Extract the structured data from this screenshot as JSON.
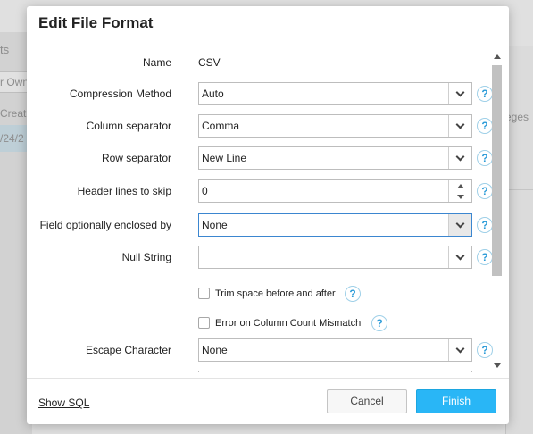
{
  "background": {
    "tab_fragment": "ts",
    "filter_fragment": "r Own",
    "column_fragment": "Creati",
    "row_fragment": "/24/2",
    "right_fragment": "eges"
  },
  "dialog": {
    "title": "Edit File Format",
    "fields": {
      "name_label": "Name",
      "name_value": "CSV",
      "compression_label": "Compression Method",
      "compression_value": "Auto",
      "column_sep_label": "Column separator",
      "column_sep_value": "Comma",
      "row_sep_label": "Row separator",
      "row_sep_value": "New Line",
      "header_lines_label": "Header lines to skip",
      "header_lines_value": "0",
      "enclosed_label": "Field optionally enclosed by",
      "enclosed_value": "None",
      "null_string_label": "Null String",
      "null_string_value": "",
      "trim_label": "Trim space before and after",
      "trim_checked": false,
      "error_count_label": "Error on Column Count Mismatch",
      "error_count_checked": false,
      "escape_label": "Escape Character",
      "escape_value": "None"
    },
    "help_glyph": "?",
    "footer": {
      "show_sql": "Show SQL",
      "cancel": "Cancel",
      "finish": "Finish"
    }
  },
  "colors": {
    "accent": "#29b6f6",
    "focus_border": "#3b86d0",
    "help": "#2d9cd8"
  }
}
